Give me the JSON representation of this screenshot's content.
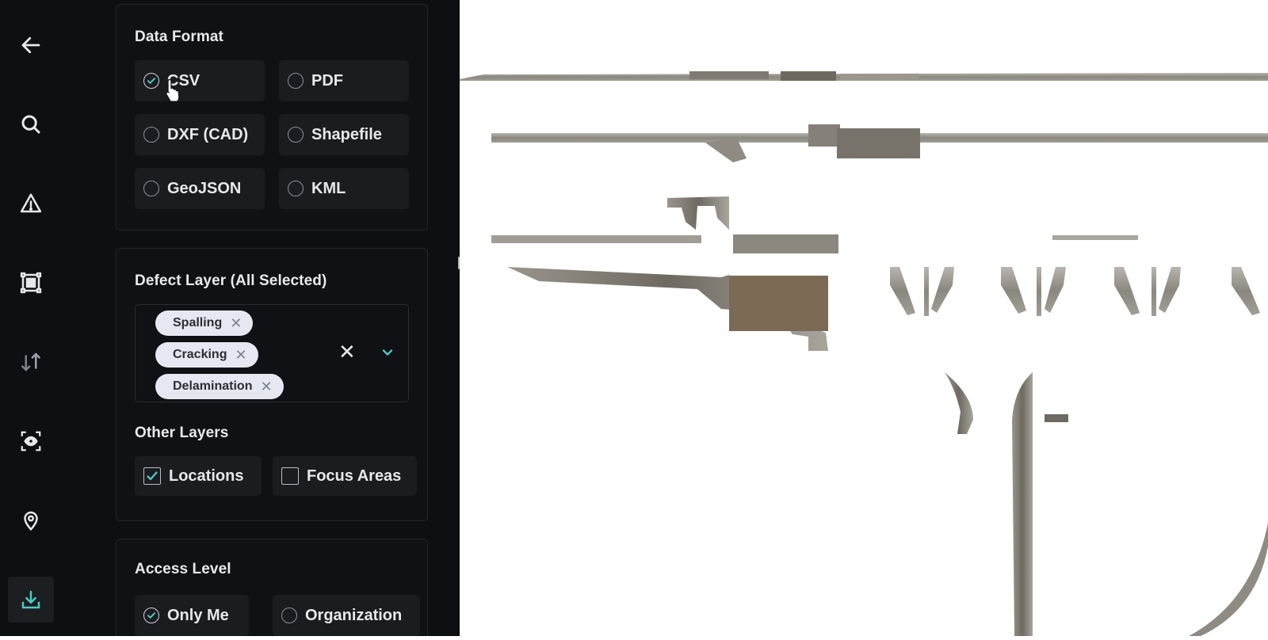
{
  "rail": {
    "items": [
      {
        "icon": "arrow-left-icon"
      },
      {
        "icon": "search-icon"
      },
      {
        "icon": "warning-icon"
      },
      {
        "icon": "frame-icon"
      },
      {
        "icon": "sort-icon"
      },
      {
        "icon": "eye-icon"
      },
      {
        "icon": "location-pin-icon"
      },
      {
        "icon": "download-icon",
        "active": true
      }
    ]
  },
  "data_format": {
    "title": "Data Format",
    "selected": "CSV",
    "options": [
      "CSV",
      "PDF",
      "DXF (CAD)",
      "Shapefile",
      "GeoJSON",
      "KML"
    ]
  },
  "defect_layer": {
    "title": "Defect Layer (All Selected)",
    "chips": [
      "Spalling",
      "Cracking",
      "Delamination"
    ],
    "clear_symbol": "✕",
    "chip_remove_symbol": "✕"
  },
  "other_layers": {
    "title": "Other Layers",
    "options": [
      {
        "label": "Locations",
        "checked": true
      },
      {
        "label": "Focus Areas",
        "checked": false
      }
    ]
  },
  "access_level": {
    "title": "Access Level",
    "selected": "Only Me",
    "options": [
      "Only Me",
      "Organization"
    ]
  },
  "colors": {
    "accent": "#4ec9c0",
    "panel_bg": "#0e0f12",
    "option_bg": "#1b1c20",
    "chip_bg": "#e5e8f0"
  }
}
